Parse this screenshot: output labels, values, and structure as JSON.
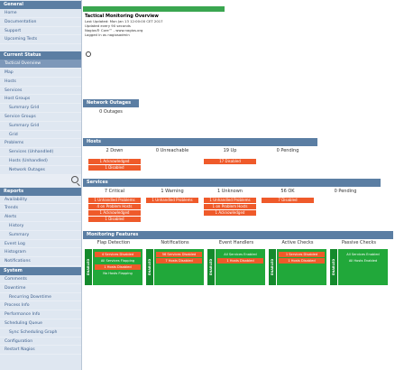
{
  "sidebar": {
    "section_general": "General",
    "general_items": [
      "Home",
      "Documentation",
      "Support",
      "Upcoming Tests"
    ],
    "section_current": "Current Status",
    "current_items": [
      {
        "label": "Tactical Overview",
        "sub": false
      },
      {
        "label": "Map",
        "sub": false
      },
      {
        "label": "Hosts",
        "sub": false
      },
      {
        "label": "Services",
        "sub": false
      },
      {
        "label": "Host Groups",
        "sub": false
      },
      {
        "label": "Summary Grid",
        "sub": true
      },
      {
        "label": "Service Groups",
        "sub": false
      },
      {
        "label": "Summary Grid",
        "sub": true
      },
      {
        "label": "Grid",
        "sub": true
      },
      {
        "label": "Problems",
        "sub": false
      },
      {
        "label": "Services (Unhandled)",
        "sub": true
      },
      {
        "label": "Hosts (Unhandled)",
        "sub": true
      },
      {
        "label": "Network Outages",
        "sub": true
      }
    ],
    "section_reports": "Reports",
    "report_items": [
      {
        "label": "Availability",
        "sub": false
      },
      {
        "label": "Trends",
        "sub": false
      },
      {
        "label": "Alerts",
        "sub": false
      },
      {
        "label": "History",
        "sub": true
      },
      {
        "label": "Summary",
        "sub": true
      },
      {
        "label": "Event Log",
        "sub": false
      },
      {
        "label": "Histogram",
        "sub": false
      },
      {
        "label": "Notifications",
        "sub": false
      }
    ],
    "section_system": "System",
    "system_items": [
      {
        "label": "Comments",
        "sub": false
      },
      {
        "label": "Downtime",
        "sub": false
      },
      {
        "label": "Recurring Downtime",
        "sub": true
      },
      {
        "label": "Process Info",
        "sub": false
      },
      {
        "label": "Performance Info",
        "sub": false
      },
      {
        "label": "Scheduling Queue",
        "sub": false
      },
      {
        "label": "Sync Scheduling Graph",
        "sub": true
      },
      {
        "label": "Configuration",
        "sub": false
      },
      {
        "label": "Restart Nagios",
        "sub": false
      }
    ]
  },
  "header": {
    "title": "Tactical Monitoring Overview",
    "lines": [
      "Last Updated: Mon Jan 13 12:00:00 CET 2017",
      "Updated every 90 seconds",
      "Nagios® Core™ - www.nagios.org",
      "Logged in as nagiosadmin"
    ]
  },
  "outages": {
    "title": "Network Outages",
    "value": "0 Outages"
  },
  "hosts": {
    "title": "Hosts",
    "cols": [
      "2 Down",
      "0 Unreachable",
      "19 Up",
      "0 Pending"
    ],
    "down_badges": [
      "1 Acknowledged",
      "1 Disabled"
    ],
    "up_badges": [
      "17 Disabled"
    ]
  },
  "services": {
    "title": "Services",
    "cols": [
      "7 Critical",
      "1 Warning",
      "1 Unknown",
      "56 OK",
      "0 Pending"
    ],
    "critical_badges": [
      "1 Unhandled Problems",
      "4 on Problem Hosts",
      "1 Acknowledged",
      "1 Disabled"
    ],
    "warning_badges": [
      "1 Unhandled Problems"
    ],
    "unknown_badges": [
      "1 Unhandled Problems",
      "1 on Problem Hosts",
      "1 Acknowledged"
    ],
    "ok_badges": [
      "7 Disabled"
    ]
  },
  "features": {
    "title": "Monitoring Features",
    "cols": [
      {
        "name": "Flap Detection",
        "tag": "ENABLED",
        "lines": [
          {
            "t": "4 Services Disabled",
            "red": true
          },
          {
            "t": "All Services Flapping",
            "red": false
          },
          {
            "t": "1 Hosts Disabled",
            "red": true
          },
          {
            "t": "No Hosts Flapping",
            "red": false
          }
        ]
      },
      {
        "name": "Notifications",
        "tag": "ENABLED",
        "lines": [
          {
            "t": "56 Services Disabled",
            "red": true
          },
          {
            "t": "7 Hosts Disabled",
            "red": true
          }
        ]
      },
      {
        "name": "Event Handlers",
        "tag": "ENABLED",
        "lines": [
          {
            "t": "All Services Enabled",
            "red": false
          },
          {
            "t": "1 Hosts Disabled",
            "red": true
          }
        ]
      },
      {
        "name": "Active Checks",
        "tag": "ENABLED",
        "lines": [
          {
            "t": "1 Services Disabled",
            "red": true
          },
          {
            "t": "1 Hosts Disabled",
            "red": true
          }
        ]
      },
      {
        "name": "Passive Checks",
        "tag": "ENABLED",
        "lines": [
          {
            "t": "All Services Enabled",
            "red": false
          },
          {
            "t": "All Hosts Enabled",
            "red": false
          }
        ]
      }
    ]
  },
  "colors": {
    "header": "#5b7ea3",
    "problem": "#ef5a2a",
    "enabled": "#21a83a",
    "sidebar": "#dfe7f1"
  }
}
